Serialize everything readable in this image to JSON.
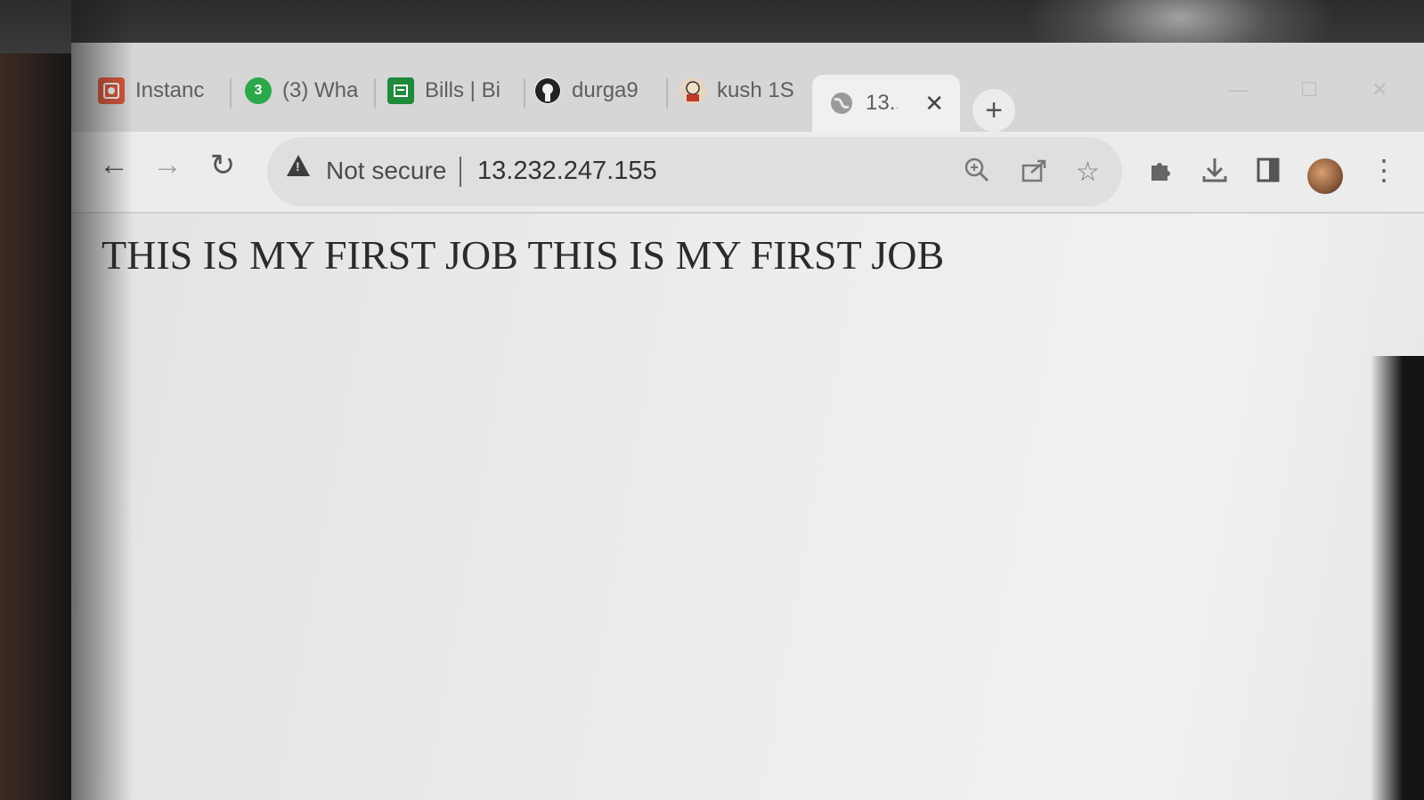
{
  "tabs": [
    {
      "label": "Instanc",
      "icon": "aws-icon",
      "color": "#d9573b"
    },
    {
      "label": "(3) Wha",
      "icon": "whatsapp-icon",
      "badge": "3",
      "color": "#2aa84a"
    },
    {
      "label": "Bills | Bi",
      "icon": "bill-icon",
      "color": "#1f8a3b"
    },
    {
      "label": "durga9",
      "icon": "github-icon",
      "color": "#222222"
    },
    {
      "label": "kush 1S",
      "icon": "jenkins-icon",
      "color": "#c0392b"
    },
    {
      "label": "13..",
      "icon": "globe-icon",
      "active": true
    }
  ],
  "toolbar": {
    "security_label": "Not secure",
    "url": "13.232.247.155"
  },
  "page": {
    "text": "THIS IS MY FIRST JOB THIS IS MY FIRST JOB"
  }
}
